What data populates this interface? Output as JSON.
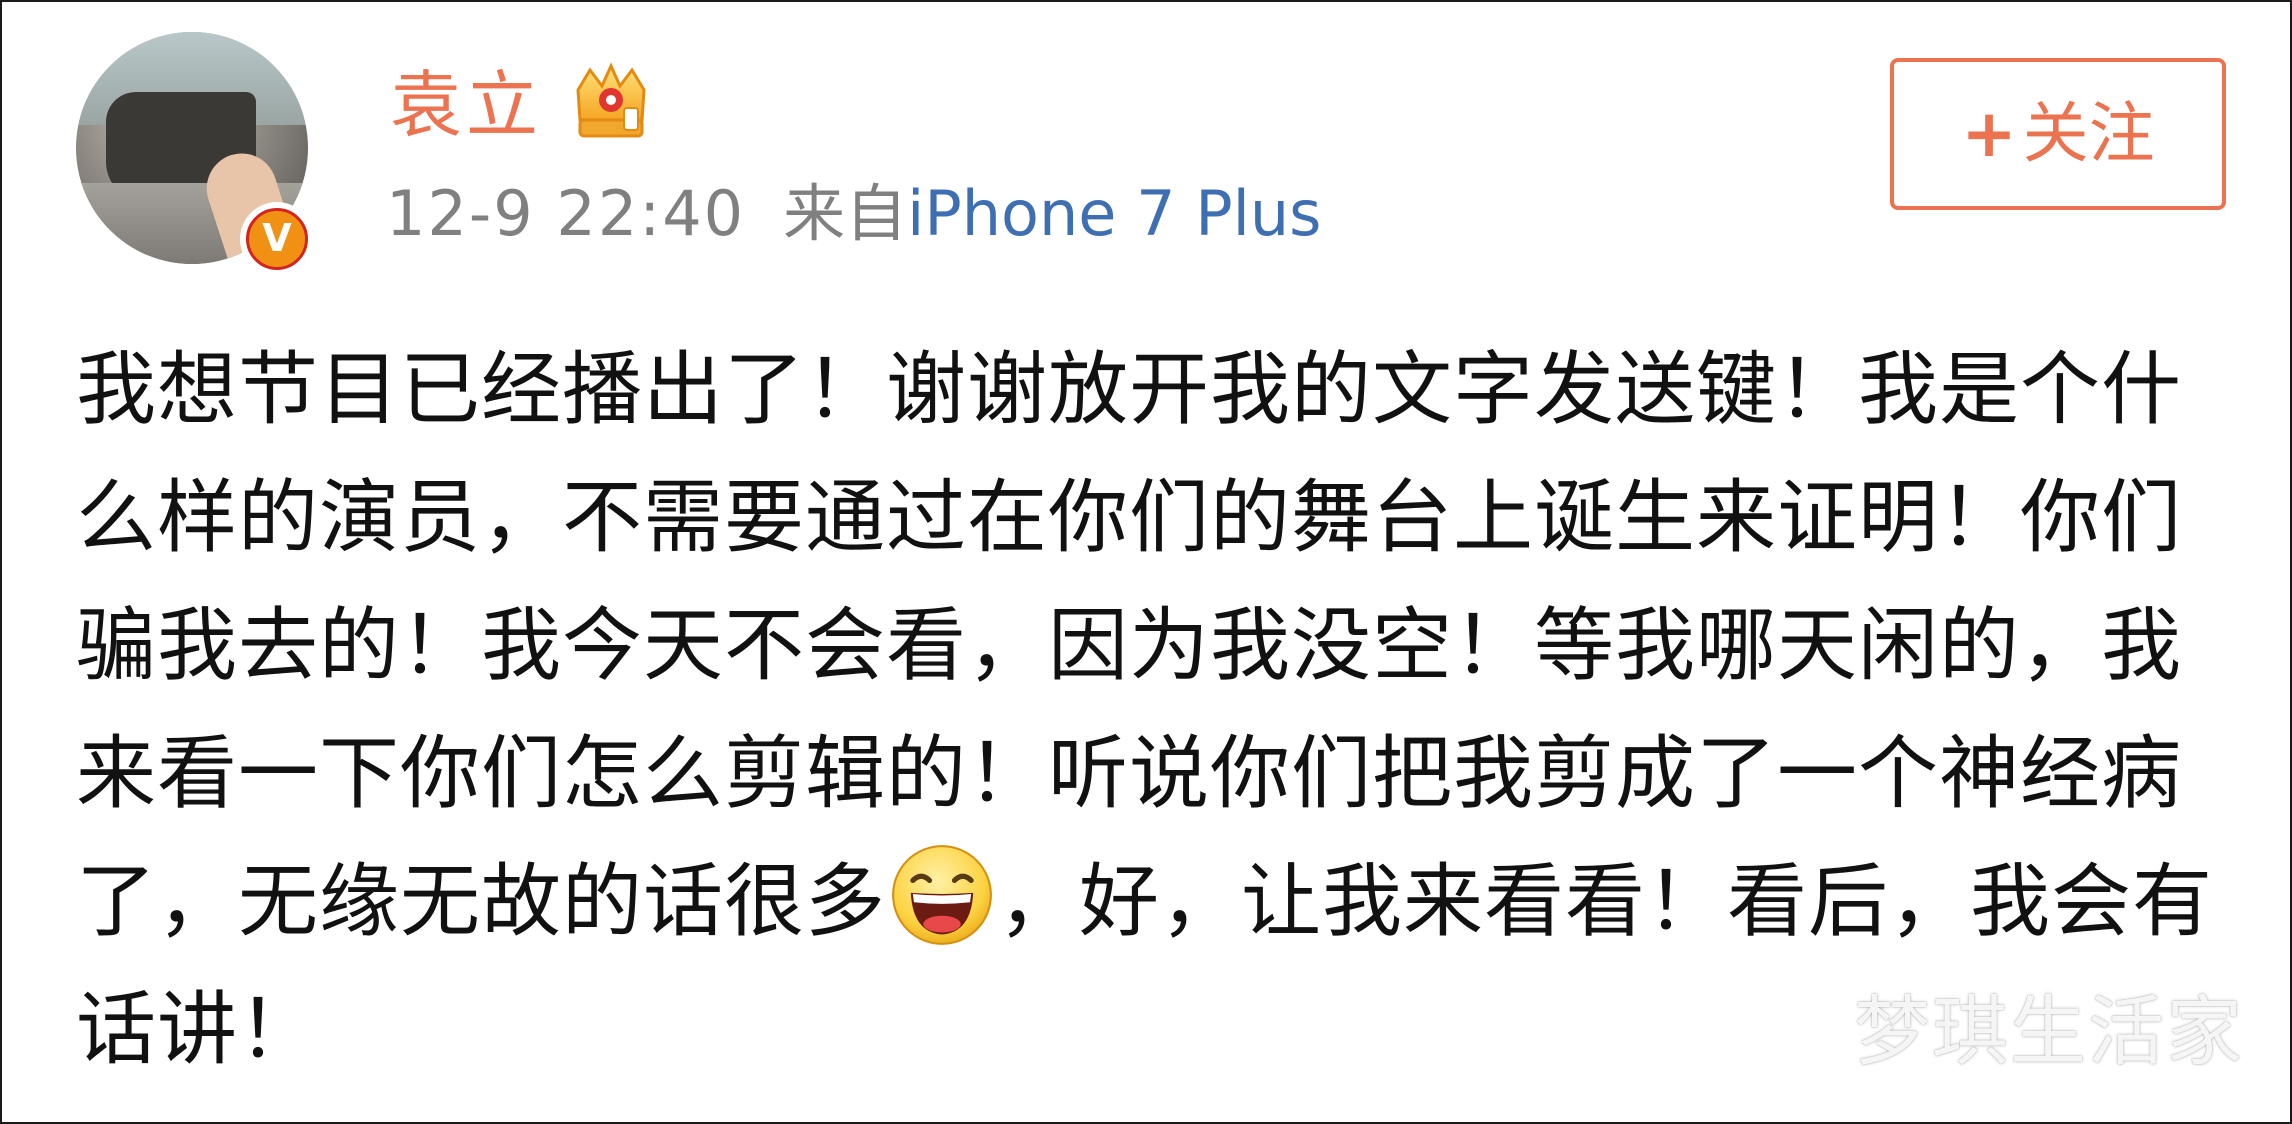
{
  "user": {
    "name": "袁立",
    "verified_badge": "V",
    "avatar_icon": "avatar",
    "vip_icon": "crown-icon"
  },
  "post_meta": {
    "time": "12-9 22:40",
    "source_prefix": "来自",
    "device": "iPhone 7 Plus"
  },
  "follow_button": {
    "plus": "+",
    "label": "关注"
  },
  "post": {
    "text_before_emoji": "我想节目已经播出了！谢谢放开我的文字发送键！我是个什么样的演员，不需要通过在你们的舞台上诞生来证明！你们骗我去的！我今天不会看，因为我没空！等我哪天闲的，我来看一下你们怎么剪辑的！听说你们把我剪成了一个神经病了，无缘无故的话很多",
    "emoji_icon": "laughing-emoji-icon",
    "text_after_emoji": "，好，让我来看看！看后，我会有话讲！"
  },
  "watermark": "梦琪生活家",
  "colors": {
    "accent": "#eb7350",
    "link": "#3f6fb3",
    "meta_gray": "#808080",
    "text": "#111111",
    "verified_orange": "#f09113",
    "verified_ring": "#d3241f"
  }
}
